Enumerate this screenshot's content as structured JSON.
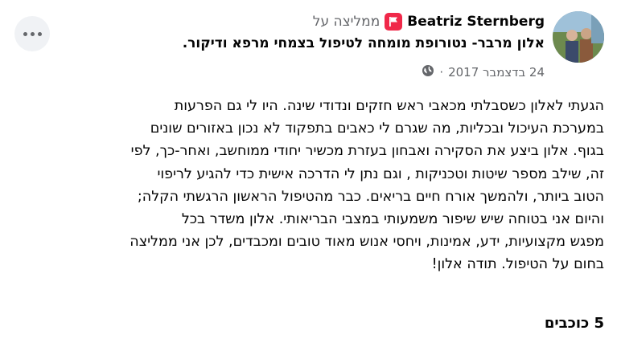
{
  "review": {
    "author": "Beatriz Sternberg",
    "recommends_text": "ממליצה על",
    "subject": "אלון מרבר- נטורופת מומחה לטיפול בצמחי מרפא ודיקור.",
    "date": "24 בדצמבר 2017",
    "separator": "·",
    "privacy_icon": "globe-icon",
    "recommend_icon": "flag-icon",
    "body": "הגעתי לאלון כשסבלתי מכאבי ראש חזקים ונדודי שינה. היו לי גם הפרעות\nבמערכת העיכול ובכליות, מה שגרם לי כאבים בתפקוד לא נכון באזורים שונים\nבגוף.  אלון ביצע את הסקירה ואבחון בעזרת מכשיר יחודי ממוחשב, ואחר-כך, לפי\nזה,  שילב מספר שיטות וטכניקות , וגם נתן לי הדרכה אישית כדי להגיע לריפוי\nהטוב ביותר, ולהמשך אורח חיים בריאים.    כבר מהטיפול הראשון הרגשתי הקלה;\nוהיום אני בטוחה שיש שיפור משמעותי במצבי הבריאותי.          אלון משדר בכל\nמפגש מקצועיות, ידע, אמינות, ויחסי אנוש  מאוד טובים ומכבדים, לכן אני ממליצה\nבחום על הטיפול.    תודה אלון!",
    "rating_text": "5 כוכבים"
  },
  "colors": {
    "recommend_badge": "#f02849",
    "secondary_text": "#65676b",
    "more_button_bg": "#f0f2f5"
  }
}
